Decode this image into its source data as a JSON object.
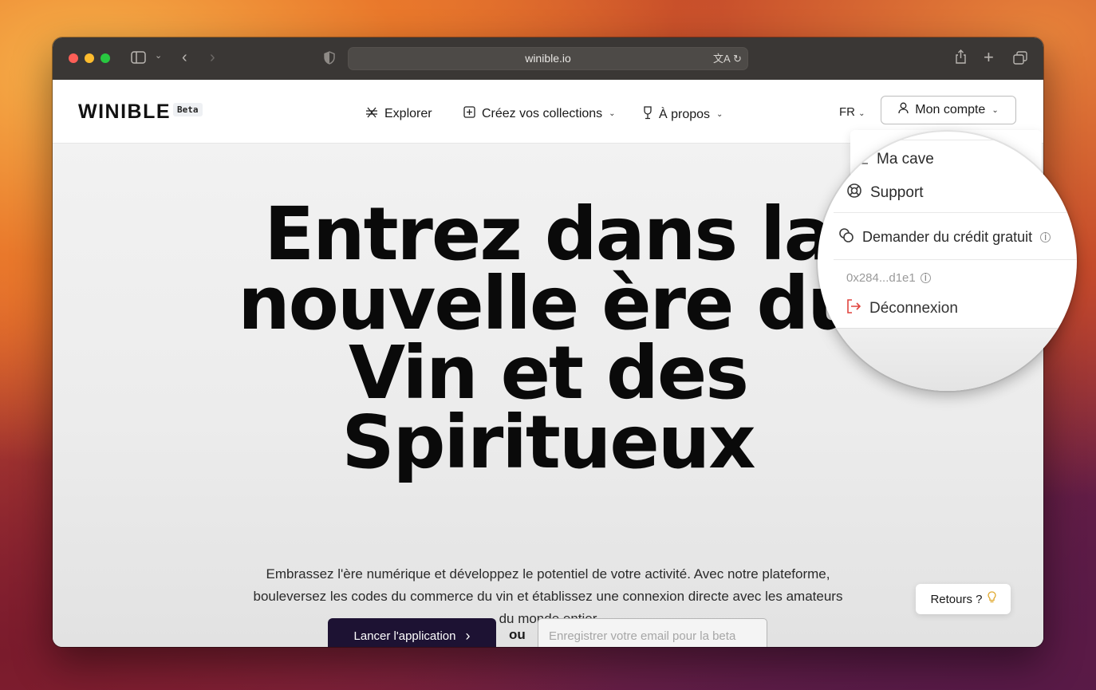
{
  "browser": {
    "url": "winible.io"
  },
  "nav": {
    "logo": "WINIBLE",
    "beta_badge": "Beta",
    "items": [
      {
        "label": "Explorer",
        "icon": "grid-sparkle-icon"
      },
      {
        "label": "Créez vos collections",
        "icon": "plus-square-icon"
      },
      {
        "label": "À propos",
        "icon": "wine-glass-icon"
      }
    ],
    "language": "FR",
    "account_label": "Mon compte"
  },
  "hero": {
    "title_lines": [
      "Entrez dans la",
      "nouvelle ère du",
      "Vin et des",
      "Spiritueux"
    ],
    "subtitle_lines": [
      "Embrassez l'ère numérique et développez le potentiel de votre activité. Avec notre plateforme,",
      "bouleversez les codes du commerce du vin et établissez une connexion directe avec les amateurs",
      "du monde entier"
    ],
    "cta_label": "Lancer l'application",
    "or_label": "ou",
    "email_placeholder": "Enregistrer votre email pour la beta"
  },
  "feedback": {
    "label": "Retours ?"
  },
  "account_menu": {
    "items": [
      {
        "label": "Ma cave",
        "icon": "chart-icon"
      },
      {
        "label": "Support",
        "icon": "lifebuoy-icon"
      },
      {
        "label": "Demander du crédit gratuit",
        "icon": "coins-icon"
      }
    ],
    "wallet_address": "0x284...d1e1",
    "logout_label": "Déconnexion"
  },
  "colors": {
    "cta_bg": "#1d1233",
    "logout_icon": "#e0443e",
    "bulb": "#e0a72a"
  }
}
